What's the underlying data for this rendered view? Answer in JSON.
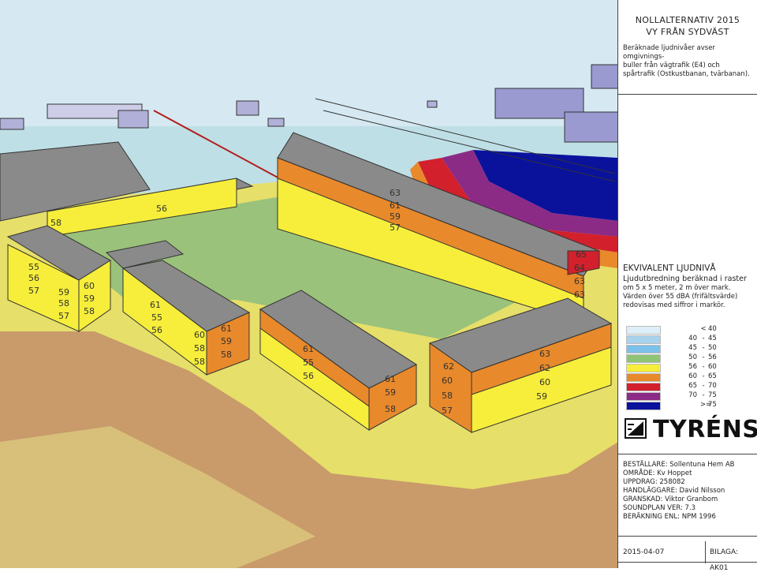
{
  "title": {
    "line1": "NOLLALTERNATIV 2015",
    "line2": "VY FRÅN SYDVÄST"
  },
  "description": {
    "line1": "Beräknade ljudnivåer avser omgivnings-",
    "line2": "buller från vägtrafik (E4) och",
    "line3": "spårtrafik (Ostkustbanan, tvärbanan)."
  },
  "legend": {
    "heading": "EKVIVALENT LJUDNIVÅ",
    "subheading": "Ljudutbredning beräknad i raster",
    "line1": "om 5 x 5 meter, 2 m över mark.",
    "line2": "Värden över 55 dBA (frifältsvärde)",
    "line3": "redovisas med siffror i markör.",
    "items": [
      {
        "low": "",
        "dash": "<",
        "high": "40",
        "color": "#ddeef8"
      },
      {
        "low": "40",
        "dash": "-",
        "high": "45",
        "color": "#a9d2ec"
      },
      {
        "low": "45",
        "dash": "-",
        "high": "50",
        "color": "#7cc1ea"
      },
      {
        "low": "50",
        "dash": "-",
        "high": "56",
        "color": "#8fc475"
      },
      {
        "low": "56",
        "dash": "-",
        "high": "60",
        "color": "#f6ee3a"
      },
      {
        "low": "60",
        "dash": "-",
        "high": "65",
        "color": "#e8892b"
      },
      {
        "low": "65",
        "dash": "-",
        "high": "70",
        "color": "#d2202c"
      },
      {
        "low": "70",
        "dash": "-",
        "high": "75",
        "color": "#8c2b86"
      },
      {
        "low": "",
        "dash": ">=",
        "high": "75",
        "color": "#0a129c"
      }
    ]
  },
  "logo": {
    "text": "TYRÉNS"
  },
  "info": {
    "bestallare": "BESTÄLLARE: Sollentuna Hem AB",
    "omrade": "OMRÅDE: Kv Hoppet",
    "uppdrag": "UPPDRAG: 258082",
    "handlaggare": "HANDLÄGGARE: David Nilsson",
    "granskad": "GRANSKAD: Viktor Granbom",
    "soundplan": "SOUNDPLAN VER: 7.3",
    "berakning": "BERÄKNING ENL: NPM 1996"
  },
  "footer": {
    "date": "2015-04-07",
    "bilaga": "BILAGA: AK01"
  },
  "map_labels": {
    "b1": [
      "63",
      "61",
      "59",
      "57"
    ],
    "b1_end": [
      "65",
      "64",
      "63",
      "63"
    ],
    "b2": [
      "56",
      "58"
    ],
    "b3": [
      "55",
      "56",
      "57",
      "60",
      "59",
      "58",
      "59",
      "57",
      "58"
    ],
    "b4": [
      "61",
      "55",
      "56",
      "60",
      "58",
      "58",
      "61",
      "59",
      "58"
    ],
    "b5": [
      "61",
      "55",
      "56",
      "61",
      "59",
      "58"
    ],
    "b6": [
      "62",
      "60",
      "58",
      "57",
      "63",
      "62",
      "60",
      "59"
    ]
  },
  "colors": {
    "band_40_45": "#a9d2ec",
    "band_50_56": "#8fc475",
    "band_56_60": "#f6ee3a",
    "band_60_65": "#e8892b",
    "band_ge75": "#0a129c",
    "ground_tan": "#c99a6a",
    "roof": "#8a8a8a"
  }
}
